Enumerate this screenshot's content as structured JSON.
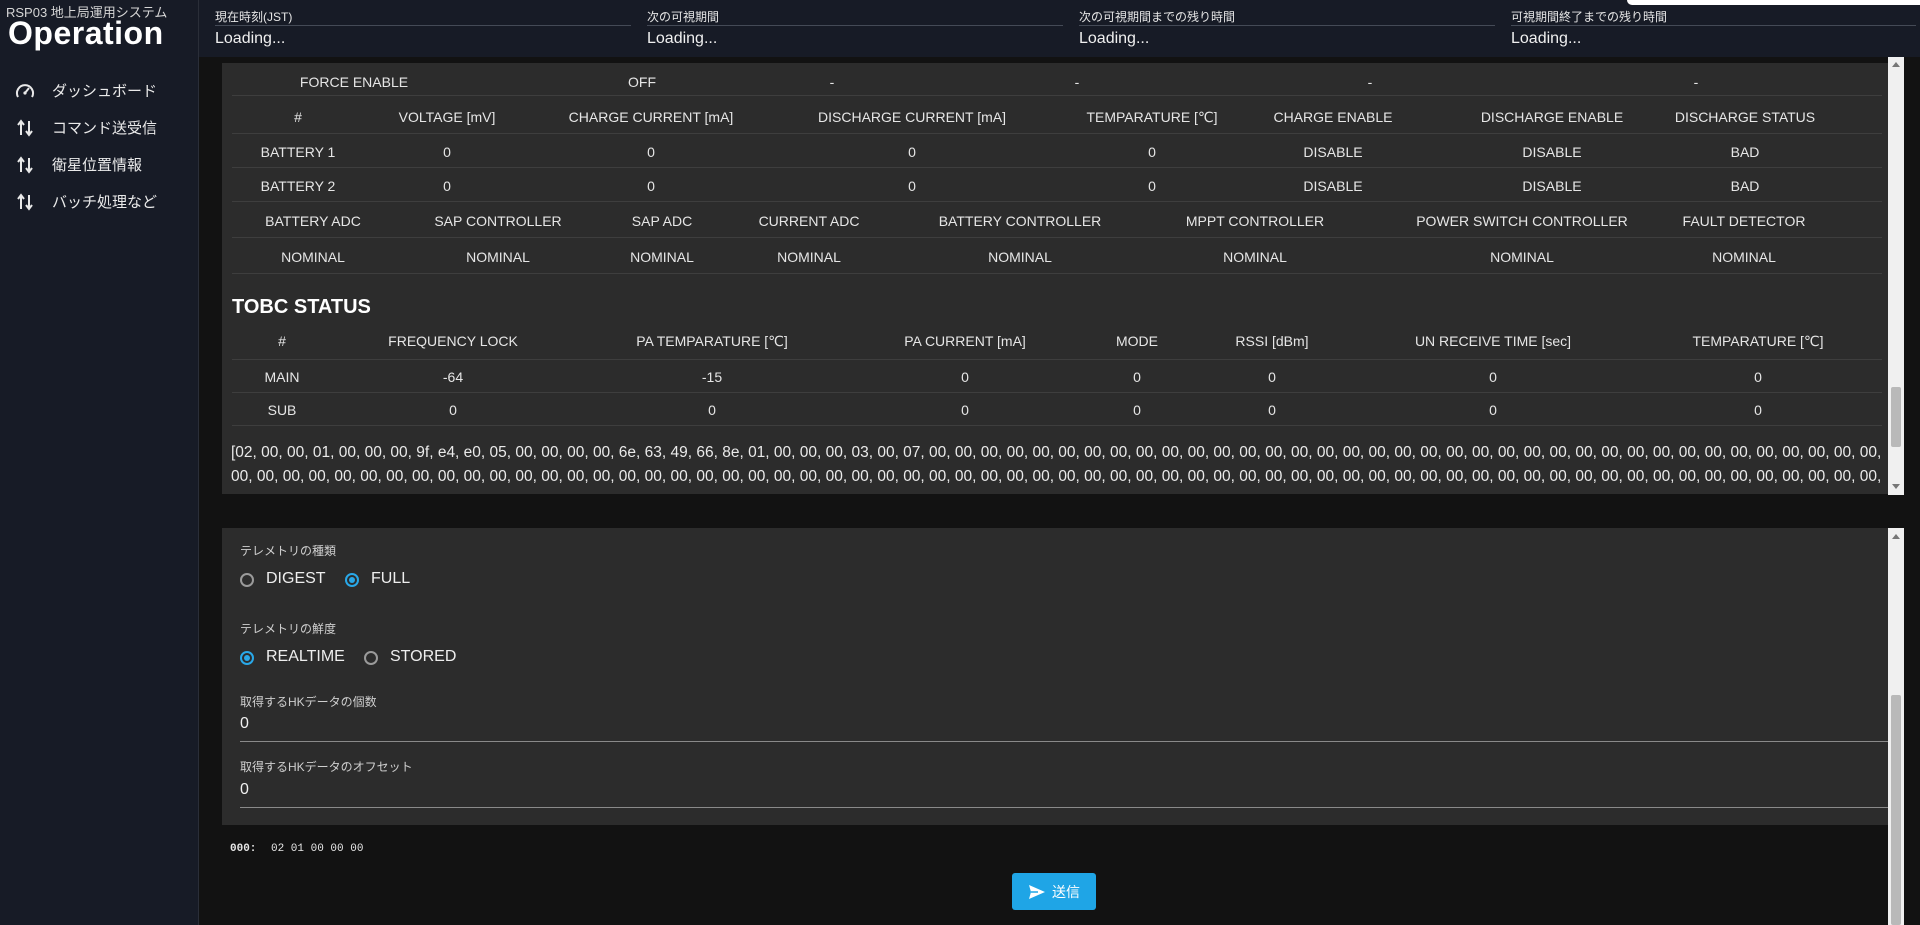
{
  "app": {
    "subtitle": "RSP03 地上局運用システム",
    "title": "Operation"
  },
  "sidebar": {
    "items": [
      {
        "label": "ダッシュボード",
        "icon": "gauge-icon"
      },
      {
        "label": "コマンド送受信",
        "icon": "swap-vertical-icon"
      },
      {
        "label": "衛星位置情報",
        "icon": "swap-vertical-icon"
      },
      {
        "label": "バッチ処理など",
        "icon": "swap-vertical-icon"
      }
    ]
  },
  "header": {
    "cols": [
      {
        "label": "現在時刻(JST)",
        "value": "Loading..."
      },
      {
        "label": "次の可視期間",
        "value": "Loading..."
      },
      {
        "label": "次の可視期間までの残り時間",
        "value": "Loading..."
      },
      {
        "label": "可視期間終了までの残り時間",
        "value": "Loading..."
      }
    ]
  },
  "force_row": {
    "label": "FORCE ENABLE",
    "value": "OFF",
    "cells": [
      "-",
      "-",
      "-",
      "-"
    ]
  },
  "battery": {
    "headers": [
      "#",
      "VOLTAGE [mV]",
      "CHARGE CURRENT [mA]",
      "DISCHARGE CURRENT [mA]",
      "TEMPARATURE [℃]",
      "CHARGE ENABLE",
      "DISCHARGE ENABLE",
      "DISCHARGE STATUS"
    ],
    "rows": [
      [
        "BATTERY 1",
        "0",
        "0",
        "0",
        "0",
        "DISABLE",
        "DISABLE",
        "BAD"
      ],
      [
        "BATTERY 2",
        "0",
        "0",
        "0",
        "0",
        "DISABLE",
        "DISABLE",
        "BAD"
      ]
    ]
  },
  "status": {
    "headers": [
      "BATTERY ADC",
      "SAP CONTROLLER",
      "SAP ADC",
      "CURRENT ADC",
      "BATTERY CONTROLLER",
      "MPPT CONTROLLER",
      "POWER SWITCH CONTROLLER",
      "FAULT DETECTOR"
    ],
    "values": [
      "NOMINAL",
      "NOMINAL",
      "NOMINAL",
      "NOMINAL",
      "NOMINAL",
      "NOMINAL",
      "NOMINAL",
      "NOMINAL"
    ]
  },
  "tobc": {
    "title": "TOBC STATUS",
    "headers": [
      "#",
      "FREQUENCY LOCK",
      "PA TEMPARATURE [℃]",
      "PA CURRENT [mA]",
      "MODE",
      "RSSI [dBm]",
      "UN RECEIVE TIME [sec]",
      "TEMPARATURE [℃]"
    ],
    "rows": [
      [
        "MAIN",
        "-64",
        "-15",
        "0",
        "0",
        "0",
        "0",
        "0"
      ],
      [
        "SUB",
        "0",
        "0",
        "0",
        "0",
        "0",
        "0",
        "0"
      ]
    ]
  },
  "hex_dump": "[02, 00, 00, 01, 00, 00, 00, 9f, e4, e0, 05, 00, 00, 00, 00, 6e, 63, 49, 66, 8e, 01, 00, 00, 00, 03, 00, 07, 00, 00, 00, 00, 00, 00, 00, 00, 00, 00, 00, 00, 00, 00, 00, 00, 00, 00, 00, 00, 00, 00, 00, 00, 00, 00, 00, 00, 00, 00, 00, 00, 00, 00, 00, 00, 00, 00, 00, 00, 00, 00, 00, 00, 00, 00, 00, 00, 00, 00, 00, 00, 00, 00, 00, 00, 00, 00, 00, 00, 00, 00, 00, 00, 00, 00, 00, 00, 00, 00, 00, 00, 00, 00, 00, 00, 00, 00, 00, 00, 00, 00, 00, 00, 00, 00, 00, 00, 00, 00, 00, 00, 00, 00, 00, 00, 00, 00, 00, 00, 00, 00, 00, 00, 00, 00, 00, 00, 00, 00, 00, 00,",
  "form": {
    "telemetry_type": {
      "label": "テレメトリの種類",
      "options": [
        "DIGEST",
        "FULL"
      ],
      "selected": "FULL"
    },
    "telemetry_freshness": {
      "label": "テレメトリの鮮度",
      "options": [
        "REALTIME",
        "STORED"
      ],
      "selected": "REALTIME"
    },
    "hk_count": {
      "label": "取得するHKデータの個数",
      "value": "0"
    },
    "hk_offset": {
      "label": "取得するHKデータのオフセット",
      "value": "0"
    }
  },
  "preview": {
    "offset": "000:",
    "bytes": "02 01 00 00 00"
  },
  "send_button": {
    "label": "送信",
    "icon": "send-icon",
    "color": "#1fa5e6"
  },
  "accent": "#29a8e8"
}
